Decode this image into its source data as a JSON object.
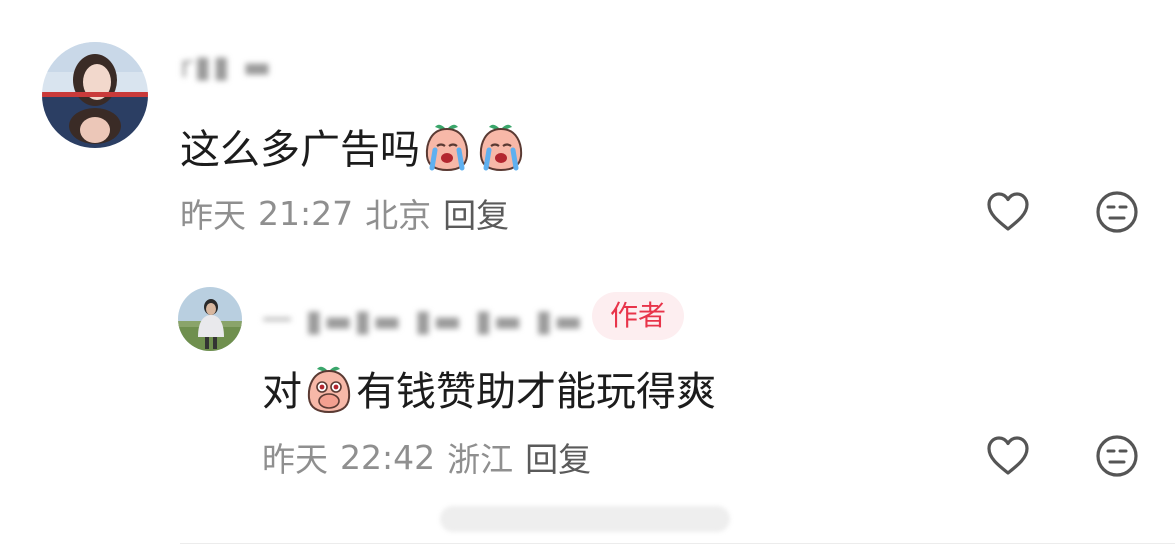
{
  "comments": [
    {
      "username": "r▮▮ ▬",
      "text": "这么多广告吗",
      "emojis": [
        "crying-peach-emoji",
        "crying-peach-emoji"
      ],
      "date": "昨天",
      "time": "21:27",
      "location": "北京",
      "reply_label": "回复"
    },
    {
      "username": "一 ▮▬▮▬ ▮▬ ▮▬ ▮▬",
      "author_badge": "作者",
      "text_before": "对",
      "emoji": "peach-cover-mouth-emoji",
      "text_after": "有钱赞助才能玩得爽",
      "date": "昨天",
      "time": "22:42",
      "location": "浙江",
      "reply_label": "回复"
    }
  ],
  "icons": {
    "like": "heart-outline-icon",
    "dislike": "neutral-face-icon"
  },
  "colors": {
    "author_badge_bg": "#fdeef0",
    "author_badge_text": "#e8344a",
    "meta_text": "#8f8f8f",
    "body_text": "#1c1c1c"
  }
}
